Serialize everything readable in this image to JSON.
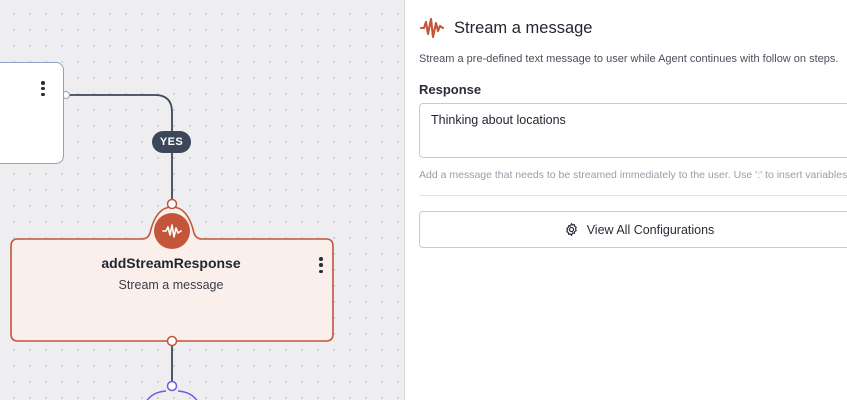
{
  "canvas": {
    "edge_label": "YES",
    "node": {
      "title": "addStreamResponse",
      "subtitle": "Stream a message",
      "icon": "waveform-icon"
    }
  },
  "panel": {
    "icon": "waveform-icon",
    "title": "Stream a message",
    "description": "Stream a pre-defined text message to user while Agent continues with follow on steps.",
    "response": {
      "label": "Response",
      "value": "Thinking about locations",
      "help": "Add a message that needs to be streamed immediately to the user. Use ':' to insert variables into"
    },
    "config_button": {
      "icon": "gear-icon",
      "label": "View All Configurations"
    }
  },
  "colors": {
    "accent": "#c2553a",
    "node_fill": "#fbefec",
    "pill": "#3d475a",
    "wire": "#3d475a",
    "connector_purple": "#6b5ce0"
  }
}
